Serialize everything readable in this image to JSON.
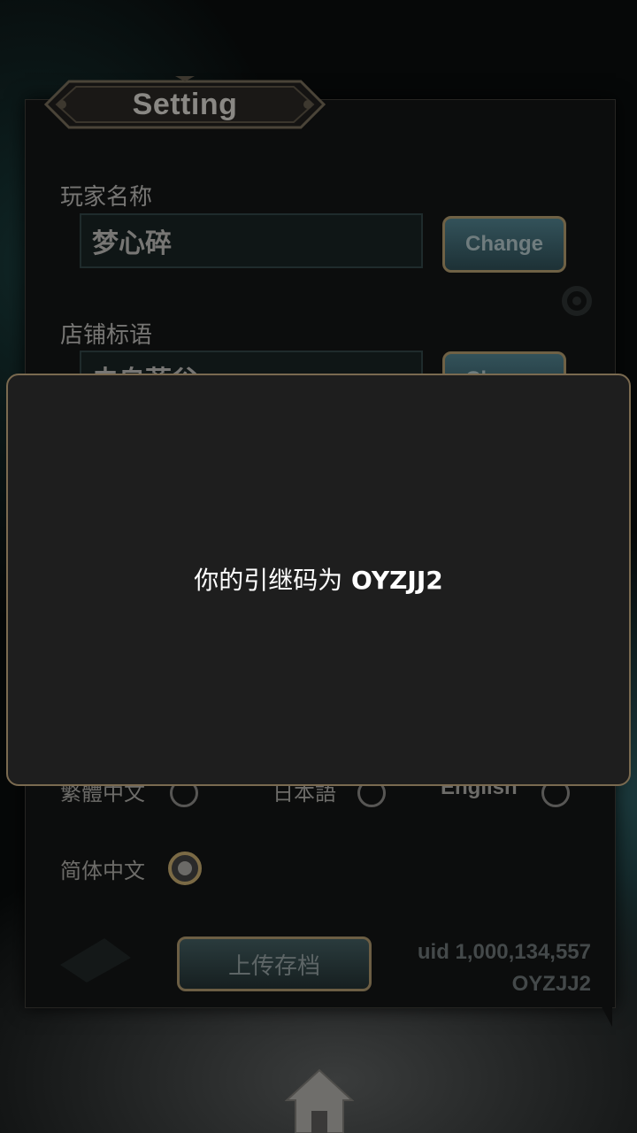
{
  "settings": {
    "title": "Setting",
    "player_name_label": "玩家名称",
    "player_name_value": "梦心碎",
    "change_label": "Change",
    "shop_slogan_label": "店铺标语",
    "shop_slogan_value": "未自菲谷",
    "languages": {
      "traditional": "繁體中文",
      "japanese": "日本語",
      "english": "English",
      "simplified": "简体中文",
      "selected": "简体中文"
    },
    "upload_label": "上传存档",
    "uid_text": "uid 1,000,134,557",
    "code_text": "OYZJJ2"
  },
  "dialog": {
    "message_prefix": "你的引继码为",
    "code": "OYZJJ2"
  },
  "colors": {
    "dialog_bg": "#1e1e1e",
    "dialog_border": "#7a6a50",
    "overlay": "#0a0c0c"
  },
  "icons": {
    "home": "home-icon",
    "settings_gear": "gear-icon"
  }
}
